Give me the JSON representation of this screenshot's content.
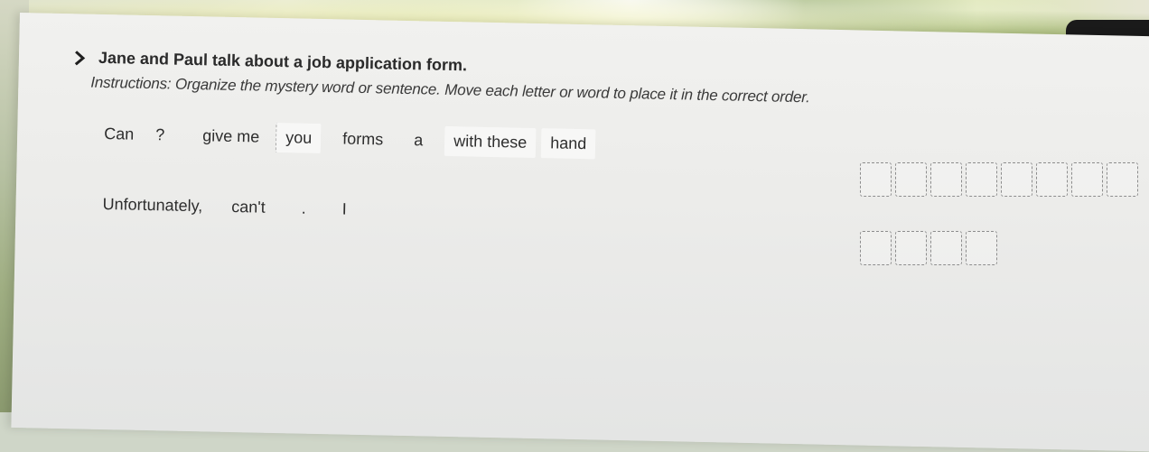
{
  "exercise": {
    "title": "Jane and Paul talk about a job application form.",
    "instructions": "Instructions: Organize the mystery word or sentence. Move each letter or word to place it in the correct order.",
    "sentence_1_words": [
      "Can",
      "?",
      "give me",
      "you",
      "forms",
      "a",
      "with these",
      "hand"
    ],
    "sentence_2_words": [
      "Unfortunately,",
      "can't",
      ".",
      "I"
    ],
    "answer_boxes_1": 8,
    "answer_boxes_2": 4
  },
  "icons": {
    "bullet": "chevron-right-icon"
  }
}
